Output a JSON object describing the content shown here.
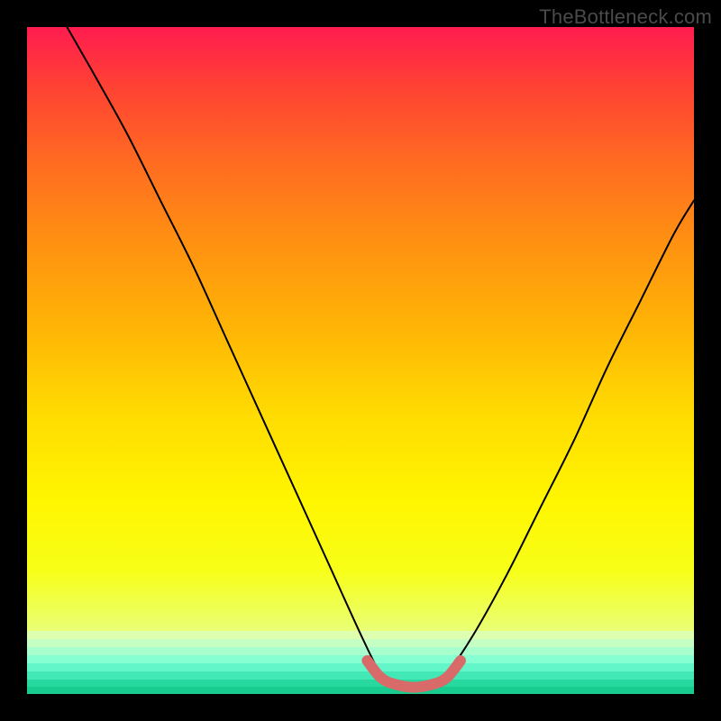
{
  "watermark": "TheBottleneck.com",
  "colors": {
    "frame_bg": "#000000",
    "watermark": "#4a4a4a",
    "curve_main": "#000000",
    "valley_highlight": "#d86a6a",
    "gradient_stops": [
      "#ff1c4f",
      "#ff4233",
      "#ff6a22",
      "#ff8f12",
      "#ffb505",
      "#ffdb02",
      "#fff500",
      "#f7ff18",
      "#e9ff76"
    ],
    "bottom_stripes": [
      "#dfffb0",
      "#c6ffc3",
      "#a8ffcd",
      "#86ffd2",
      "#63f6c8",
      "#42e8b5",
      "#28d99f",
      "#17cc8e"
    ]
  },
  "chart_data": {
    "type": "line",
    "title": "",
    "xlabel": "",
    "ylabel": "",
    "xlim": [
      0,
      100
    ],
    "ylim": [
      0,
      100
    ],
    "grid": false,
    "note": "Axes are unlabeled in the source image; x/y are normalized 0–100. The black curve appears to plot a bottleneck-style V-shaped metric, minimized around x≈55–60. A thicker salmon highlight overlays the valley bottom near y≈0.",
    "series": [
      {
        "name": "bottleneck-curve",
        "color": "#000000",
        "points": [
          {
            "x": 6,
            "y": 100
          },
          {
            "x": 10,
            "y": 93
          },
          {
            "x": 15,
            "y": 84
          },
          {
            "x": 20,
            "y": 74
          },
          {
            "x": 25,
            "y": 64
          },
          {
            "x": 30,
            "y": 53
          },
          {
            "x": 35,
            "y": 42
          },
          {
            "x": 40,
            "y": 31
          },
          {
            "x": 45,
            "y": 20
          },
          {
            "x": 50,
            "y": 9
          },
          {
            "x": 53,
            "y": 3
          },
          {
            "x": 55,
            "y": 1
          },
          {
            "x": 58,
            "y": 0.5
          },
          {
            "x": 61,
            "y": 1
          },
          {
            "x": 63,
            "y": 3
          },
          {
            "x": 67,
            "y": 9
          },
          {
            "x": 72,
            "y": 18
          },
          {
            "x": 77,
            "y": 28
          },
          {
            "x": 82,
            "y": 38
          },
          {
            "x": 87,
            "y": 49
          },
          {
            "x": 92,
            "y": 59
          },
          {
            "x": 97,
            "y": 69
          },
          {
            "x": 100,
            "y": 74
          }
        ]
      },
      {
        "name": "valley-highlight",
        "color": "#d86a6a",
        "points": [
          {
            "x": 51,
            "y": 5
          },
          {
            "x": 53,
            "y": 2.5
          },
          {
            "x": 55,
            "y": 1.5
          },
          {
            "x": 58,
            "y": 1
          },
          {
            "x": 61,
            "y": 1.5
          },
          {
            "x": 63,
            "y": 2.5
          },
          {
            "x": 65,
            "y": 5
          }
        ]
      }
    ]
  }
}
